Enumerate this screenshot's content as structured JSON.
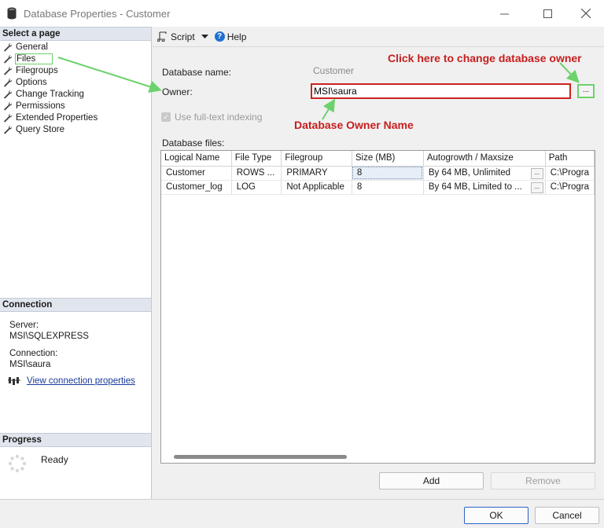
{
  "window": {
    "title": "Database Properties - Customer"
  },
  "left_pane": {
    "select_page_header": "Select a page",
    "pages": [
      {
        "label": "General",
        "selected": false
      },
      {
        "label": "Files",
        "selected": true
      },
      {
        "label": "Filegroups",
        "selected": false
      },
      {
        "label": "Options",
        "selected": false
      },
      {
        "label": "Change Tracking",
        "selected": false
      },
      {
        "label": "Permissions",
        "selected": false
      },
      {
        "label": "Extended Properties",
        "selected": false
      },
      {
        "label": "Query Store",
        "selected": false
      }
    ],
    "connection_header": "Connection",
    "server_label": "Server:",
    "server_value": "MSI\\SQLEXPRESS",
    "connection_label": "Connection:",
    "connection_value": "MSI\\saura",
    "view_connection_link": "View connection properties",
    "progress_header": "Progress",
    "progress_status": "Ready"
  },
  "toolbar": {
    "script_label": "Script",
    "help_label": "Help"
  },
  "form": {
    "database_name_label": "Database name:",
    "database_name_value": "Customer",
    "owner_label": "Owner:",
    "owner_value": "MSI\\saura",
    "browse_button_label": "...",
    "fulltext_label": "Use full-text indexing",
    "fulltext_checked": true,
    "database_files_label": "Database files:"
  },
  "files_grid": {
    "columns": [
      "Logical Name",
      "File Type",
      "Filegroup",
      "Size (MB)",
      "Autogrowth / Maxsize",
      "Path"
    ],
    "rows": [
      {
        "logical_name": "Customer",
        "file_type": "ROWS ...",
        "filegroup": "PRIMARY",
        "size": "8",
        "autogrowth": "By 64 MB, Unlimited",
        "path": "C:\\Progra"
      },
      {
        "logical_name": "Customer_log",
        "file_type": "LOG",
        "filegroup": "Not Applicable",
        "size": "8",
        "autogrowth": "By 64 MB, Limited to ...",
        "path": "C:\\Progra"
      }
    ],
    "ellipsis_label": "..."
  },
  "buttons": {
    "add": "Add",
    "remove": "Remove",
    "ok": "OK",
    "cancel": "Cancel"
  },
  "annotations": {
    "change_owner": "Click here to change database owner",
    "owner_name": "Database Owner Name",
    "annotation_color": "#c81e1e",
    "arrow_color": "#6cd26c"
  }
}
